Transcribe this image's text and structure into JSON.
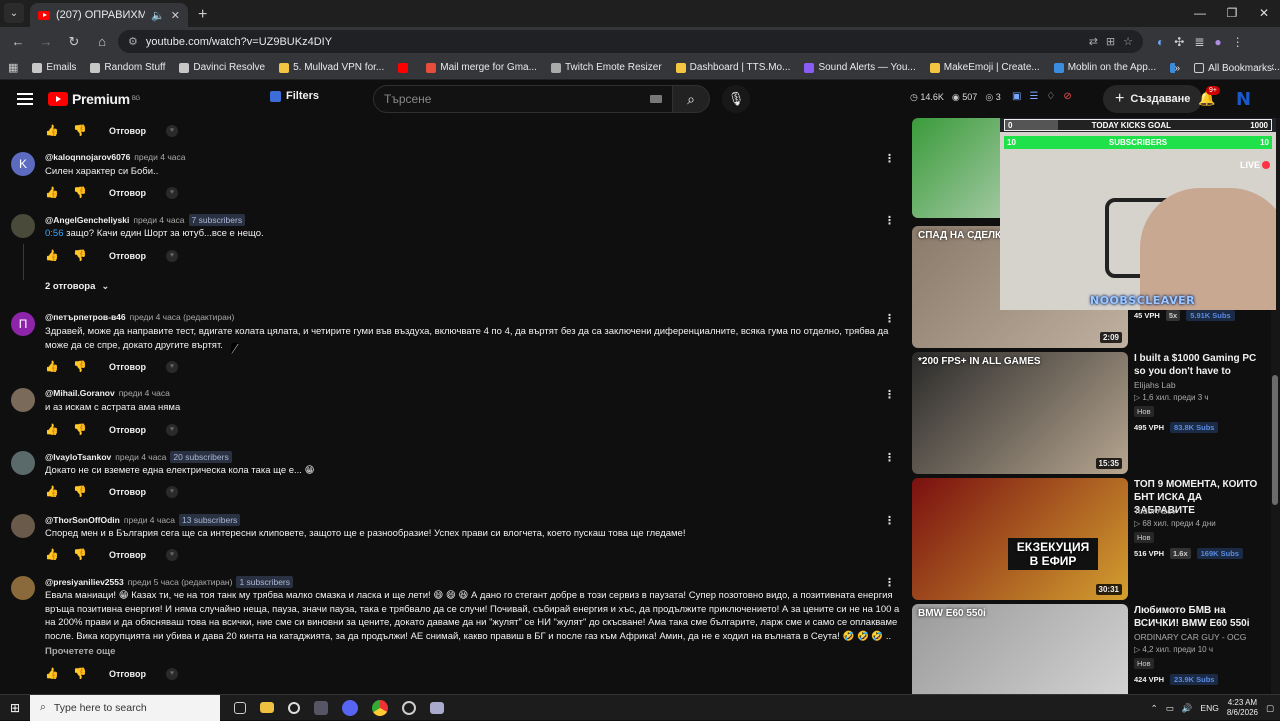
{
  "browser": {
    "tab_title": "(207) ОПРАВИХМЕ 4х4 НА",
    "url": "youtube.com/watch?v=UZ9BUKz4DIY",
    "bookmarks": [
      {
        "label": "Emails",
        "color": "#c7c7c7"
      },
      {
        "label": "Random Stuff",
        "color": "#c7c7c7"
      },
      {
        "label": "Davinci Resolve",
        "color": "#c7c7c7"
      },
      {
        "label": "5. Mullvad VPN for...",
        "color": "#f5c542"
      },
      {
        "label": "",
        "color": "#ff0000"
      },
      {
        "label": "Mail merge for Gma...",
        "color": "#e74c3c"
      },
      {
        "label": "Twitch Emote Resizer",
        "color": "#aaaaaa"
      },
      {
        "label": "Dashboard | TTS.Mo...",
        "color": "#f5c542"
      },
      {
        "label": "Sound Alerts — You...",
        "color": "#8a5cf6"
      },
      {
        "label": "MakeEmoji | Create...",
        "color": "#f5c542"
      },
      {
        "label": "Moblin on the App...",
        "color": "#3a8dde"
      },
      {
        "label": "Hype Train - #1 Kick...",
        "color": "#3a8dde"
      }
    ],
    "all_bookmarks": "All Bookmarks"
  },
  "yt": {
    "logo_text": "Premium",
    "logo_region": "BG",
    "filters": "Filters",
    "search_placeholder": "Търсене",
    "stats": {
      "likes": "14.6K",
      "viewers": "507",
      "count": "3"
    },
    "create": "Създаване",
    "notif_badge": "9+",
    "avatar_letter": "N"
  },
  "comments": {
    "reply_label": "Отговор",
    "replies_toggle": "2 отговора",
    "read_more": "Прочетете още",
    "items": [
      {
        "handle": "@kaloqnnojarov6076",
        "time": "преди 4 часа",
        "subs": "",
        "avatar": "K",
        "avatar_color": "#5c6bc0",
        "text": "Силен характер си Боби.."
      },
      {
        "handle": "@AngelGencheliyski",
        "time": "преди 4 часа",
        "subs": "7 subscribers",
        "avatar": "",
        "avatar_color": "#4a4a3a",
        "timestamp": "0:56",
        "text": " защо? Качи един Шорт за ютуб...все е нещо."
      },
      {
        "handle": "@петърпетров-в46",
        "time": "преди 4 часа (редактиран)",
        "subs": "",
        "avatar": "П",
        "avatar_color": "#8e24aa",
        "text": "Здравей,  може да направите тест, вдигате колата цялата, и четирите гуми във въздуха, включвате 4 по 4, да въртят без да са заключени диференциалните,  всяка гума по отделно, трябва да може да се спре, докато другите въртят."
      },
      {
        "handle": "@Mihail.Goranov",
        "time": "преди 4 часа",
        "subs": "",
        "avatar": "",
        "avatar_color": "#7a6a5a",
        "text": "и аз искам с астрата ама няма"
      },
      {
        "handle": "@IvayloTsankov",
        "time": "преди 4 часа",
        "subs": "20 subscribers",
        "avatar": "",
        "avatar_color": "#5a6a6a",
        "text": "Докато не си вземете една електрическа кола така ще е... 😁"
      },
      {
        "handle": "@ThorSonOffOdin",
        "time": "преди 4 часа",
        "subs": "13 subscribers",
        "avatar": "",
        "avatar_color": "#6a5a4a",
        "text": "Според мен и в България сега ще са интересни клиповете, защото ще е разнообразие! Успех прави си влогчета, което пускаш това ще гледаме!"
      },
      {
        "handle": "@presiyaniliev2553",
        "time": "преди 5 часа (редактиран)",
        "subs": "1 subscribers",
        "avatar": "",
        "avatar_color": "#8a6a3a",
        "text": "Евала маниаци! 😁 Казах ти, че на тоя танк му трябва малко смазка и ласка и ще лети! 😄 😄 😆 А дано го стегант добре в този сервиз в паузата! Супер позотовно видо, а позитивната енергия връща позитивна енергия! И няма случайно неща, пауза, значи пауза, така е трябвало да се случи! Почивай, събирай енергия и хъс, да продължите приключението! А за цените си не на 100 а на 200% прави и да обясняваш това на всички, ние сме си виновни за цените, докато даваме да ни \"жулят\" се НИ \"жулят\" до скъсване! Ама така сме българите, ларж сме и само се оплакваме после. Вика корупцията ни убива и дава 20 кинта на катаджията, за да продължи! АЕ снимай, какво правиш в БГ и после газ към Африка! Амин, да не е ходил на вълната в Сеута! 🤣 🤣 🤣 .."
      }
    ]
  },
  "overlay": {
    "goal_title": "TODAY KICKS GOAL",
    "goal_left": "0",
    "goal_right": "1000",
    "subs_label": "SUBSCRIBERS",
    "subs_left": "10",
    "subs_right": "10",
    "live": "LIVE",
    "streamer": "NOOBSCLEAVER"
  },
  "sidebar": {
    "videos": [
      {
        "title": "",
        "channel": "",
        "meta": "",
        "duration": "",
        "vph": "",
        "mult": "",
        "subs": "",
        "colors": [
          "#3a9b3a",
          "#e6e6e6"
        ]
      },
      {
        "title": "",
        "channel": "",
        "meta": "",
        "duration": "2:09",
        "vph": "45 VPH",
        "mult": "5x",
        "subs": "5.91K Subs",
        "caption": "СПАД НА СДЕЛКИТЕ С ИМОТИ",
        "colors": [
          "#8a7a6a",
          "#c0b0a0"
        ]
      },
      {
        "title": "I built a $1000 Gaming PC so you don't have to",
        "channel": "Elijahs Lab",
        "meta": "1,6 хил.  преди 3 ч",
        "new": "Нов",
        "duration": "15:35",
        "vph": "495 VPH",
        "mult": "",
        "subs": "83.8K Subs",
        "caption": "*200 FPS+ IN ALL GAMES",
        "colors": [
          "#2a2a2a",
          "#b7a690"
        ]
      },
      {
        "title": "ТОП 9 МОМЕНТА, КОИТО БНТ ИСКА ДА ЗАБРАВИТЕ",
        "channel": "Todor Azov",
        "meta": "68 хил.  преди 4 дни",
        "new": "Нов",
        "duration": "30:31",
        "vph": "516 VPH",
        "mult": "1.6x",
        "subs": "169K Subs",
        "caption": "ЕКЗЕКУЦИЯ В ЕФИР",
        "colors": [
          "#7a1010",
          "#d4a030"
        ]
      },
      {
        "title": "Любимото БМВ на ВСИЧКИ! BMW E60 550i",
        "channel": "ORDINARY CAR GUY - OCG",
        "meta": "4,2 хил.  преди 10 ч",
        "new": "Нов",
        "duration": "",
        "vph": "424 VPH",
        "mult": "",
        "subs": "23.9K Subs",
        "caption": "BMW E60 550i",
        "colors": [
          "#9a9a9a",
          "#d8d8d8"
        ]
      }
    ]
  },
  "taskbar": {
    "search": "Type here to search",
    "lang": "ENG",
    "time": "4:23 AM",
    "date": "8/6/2026"
  }
}
